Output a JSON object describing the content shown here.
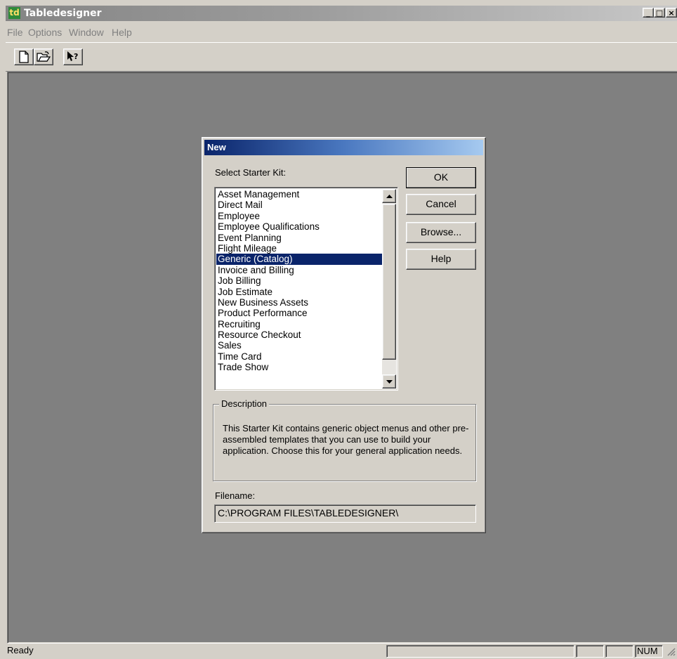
{
  "app": {
    "icon_text": "td",
    "title": "Tabledesigner",
    "window_controls": {
      "minimize": "_",
      "maximize": "□",
      "close": "×"
    }
  },
  "menu": [
    "File",
    "Options",
    "Window",
    "Help"
  ],
  "toolbar": {
    "buttons": [
      {
        "icon": "new-document-icon"
      },
      {
        "icon": "open-folder-icon"
      },
      {
        "icon": "context-help-icon"
      }
    ]
  },
  "dialog": {
    "title": "New",
    "select_label": "Select Starter Kit:",
    "starter_kits": [
      "Asset Management",
      "Direct Mail",
      "Employee",
      "Employee Qualifications",
      "Event Planning",
      "Flight Mileage",
      "Generic (Catalog)",
      "Invoice and Billing",
      "Job Billing",
      "Job Estimate",
      "New Business Assets",
      "Product Performance",
      "Recruiting",
      "Resource Checkout",
      "Sales",
      "Time Card",
      "Trade Show"
    ],
    "selected_kit": "Generic (Catalog)",
    "buttons": {
      "ok": "OK",
      "cancel": "Cancel",
      "browse": "Browse...",
      "help": "Help"
    },
    "description_label": "Description",
    "description_text": "This Starter Kit contains generic object menus and other pre-assembled templates that you can use to build your application.  Choose this for your general application needs.",
    "filename_label": "Filename:",
    "filename_value": "C:\\PROGRAM FILES\\TABLEDESIGNER\\"
  },
  "status": {
    "text": "Ready",
    "num_indicator": "NUM"
  },
  "colors": {
    "selection": "#0a246a",
    "workspace": "#808080",
    "face": "#d4d0c8"
  }
}
